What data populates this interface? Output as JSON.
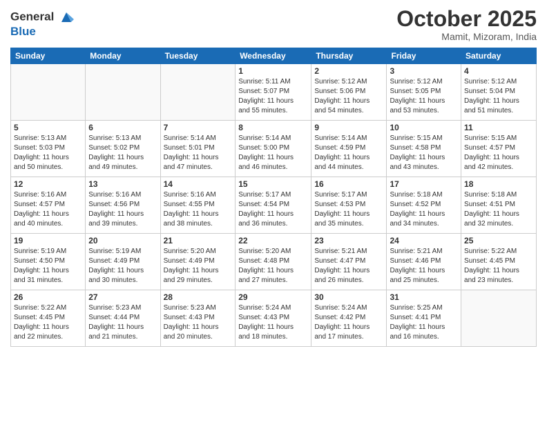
{
  "header": {
    "logo_line1": "General",
    "logo_line2": "Blue",
    "month": "October 2025",
    "location": "Mamit, Mizoram, India"
  },
  "weekdays": [
    "Sunday",
    "Monday",
    "Tuesday",
    "Wednesday",
    "Thursday",
    "Friday",
    "Saturday"
  ],
  "weeks": [
    [
      {
        "day": "",
        "info": ""
      },
      {
        "day": "",
        "info": ""
      },
      {
        "day": "",
        "info": ""
      },
      {
        "day": "1",
        "info": "Sunrise: 5:11 AM\nSunset: 5:07 PM\nDaylight: 11 hours\nand 55 minutes."
      },
      {
        "day": "2",
        "info": "Sunrise: 5:12 AM\nSunset: 5:06 PM\nDaylight: 11 hours\nand 54 minutes."
      },
      {
        "day": "3",
        "info": "Sunrise: 5:12 AM\nSunset: 5:05 PM\nDaylight: 11 hours\nand 53 minutes."
      },
      {
        "day": "4",
        "info": "Sunrise: 5:12 AM\nSunset: 5:04 PM\nDaylight: 11 hours\nand 51 minutes."
      }
    ],
    [
      {
        "day": "5",
        "info": "Sunrise: 5:13 AM\nSunset: 5:03 PM\nDaylight: 11 hours\nand 50 minutes."
      },
      {
        "day": "6",
        "info": "Sunrise: 5:13 AM\nSunset: 5:02 PM\nDaylight: 11 hours\nand 49 minutes."
      },
      {
        "day": "7",
        "info": "Sunrise: 5:14 AM\nSunset: 5:01 PM\nDaylight: 11 hours\nand 47 minutes."
      },
      {
        "day": "8",
        "info": "Sunrise: 5:14 AM\nSunset: 5:00 PM\nDaylight: 11 hours\nand 46 minutes."
      },
      {
        "day": "9",
        "info": "Sunrise: 5:14 AM\nSunset: 4:59 PM\nDaylight: 11 hours\nand 44 minutes."
      },
      {
        "day": "10",
        "info": "Sunrise: 5:15 AM\nSunset: 4:58 PM\nDaylight: 11 hours\nand 43 minutes."
      },
      {
        "day": "11",
        "info": "Sunrise: 5:15 AM\nSunset: 4:57 PM\nDaylight: 11 hours\nand 42 minutes."
      }
    ],
    [
      {
        "day": "12",
        "info": "Sunrise: 5:16 AM\nSunset: 4:57 PM\nDaylight: 11 hours\nand 40 minutes."
      },
      {
        "day": "13",
        "info": "Sunrise: 5:16 AM\nSunset: 4:56 PM\nDaylight: 11 hours\nand 39 minutes."
      },
      {
        "day": "14",
        "info": "Sunrise: 5:16 AM\nSunset: 4:55 PM\nDaylight: 11 hours\nand 38 minutes."
      },
      {
        "day": "15",
        "info": "Sunrise: 5:17 AM\nSunset: 4:54 PM\nDaylight: 11 hours\nand 36 minutes."
      },
      {
        "day": "16",
        "info": "Sunrise: 5:17 AM\nSunset: 4:53 PM\nDaylight: 11 hours\nand 35 minutes."
      },
      {
        "day": "17",
        "info": "Sunrise: 5:18 AM\nSunset: 4:52 PM\nDaylight: 11 hours\nand 34 minutes."
      },
      {
        "day": "18",
        "info": "Sunrise: 5:18 AM\nSunset: 4:51 PM\nDaylight: 11 hours\nand 32 minutes."
      }
    ],
    [
      {
        "day": "19",
        "info": "Sunrise: 5:19 AM\nSunset: 4:50 PM\nDaylight: 11 hours\nand 31 minutes."
      },
      {
        "day": "20",
        "info": "Sunrise: 5:19 AM\nSunset: 4:49 PM\nDaylight: 11 hours\nand 30 minutes."
      },
      {
        "day": "21",
        "info": "Sunrise: 5:20 AM\nSunset: 4:49 PM\nDaylight: 11 hours\nand 29 minutes."
      },
      {
        "day": "22",
        "info": "Sunrise: 5:20 AM\nSunset: 4:48 PM\nDaylight: 11 hours\nand 27 minutes."
      },
      {
        "day": "23",
        "info": "Sunrise: 5:21 AM\nSunset: 4:47 PM\nDaylight: 11 hours\nand 26 minutes."
      },
      {
        "day": "24",
        "info": "Sunrise: 5:21 AM\nSunset: 4:46 PM\nDaylight: 11 hours\nand 25 minutes."
      },
      {
        "day": "25",
        "info": "Sunrise: 5:22 AM\nSunset: 4:45 PM\nDaylight: 11 hours\nand 23 minutes."
      }
    ],
    [
      {
        "day": "26",
        "info": "Sunrise: 5:22 AM\nSunset: 4:45 PM\nDaylight: 11 hours\nand 22 minutes."
      },
      {
        "day": "27",
        "info": "Sunrise: 5:23 AM\nSunset: 4:44 PM\nDaylight: 11 hours\nand 21 minutes."
      },
      {
        "day": "28",
        "info": "Sunrise: 5:23 AM\nSunset: 4:43 PM\nDaylight: 11 hours\nand 20 minutes."
      },
      {
        "day": "29",
        "info": "Sunrise: 5:24 AM\nSunset: 4:43 PM\nDaylight: 11 hours\nand 18 minutes."
      },
      {
        "day": "30",
        "info": "Sunrise: 5:24 AM\nSunset: 4:42 PM\nDaylight: 11 hours\nand 17 minutes."
      },
      {
        "day": "31",
        "info": "Sunrise: 5:25 AM\nSunset: 4:41 PM\nDaylight: 11 hours\nand 16 minutes."
      },
      {
        "day": "",
        "info": ""
      }
    ]
  ]
}
